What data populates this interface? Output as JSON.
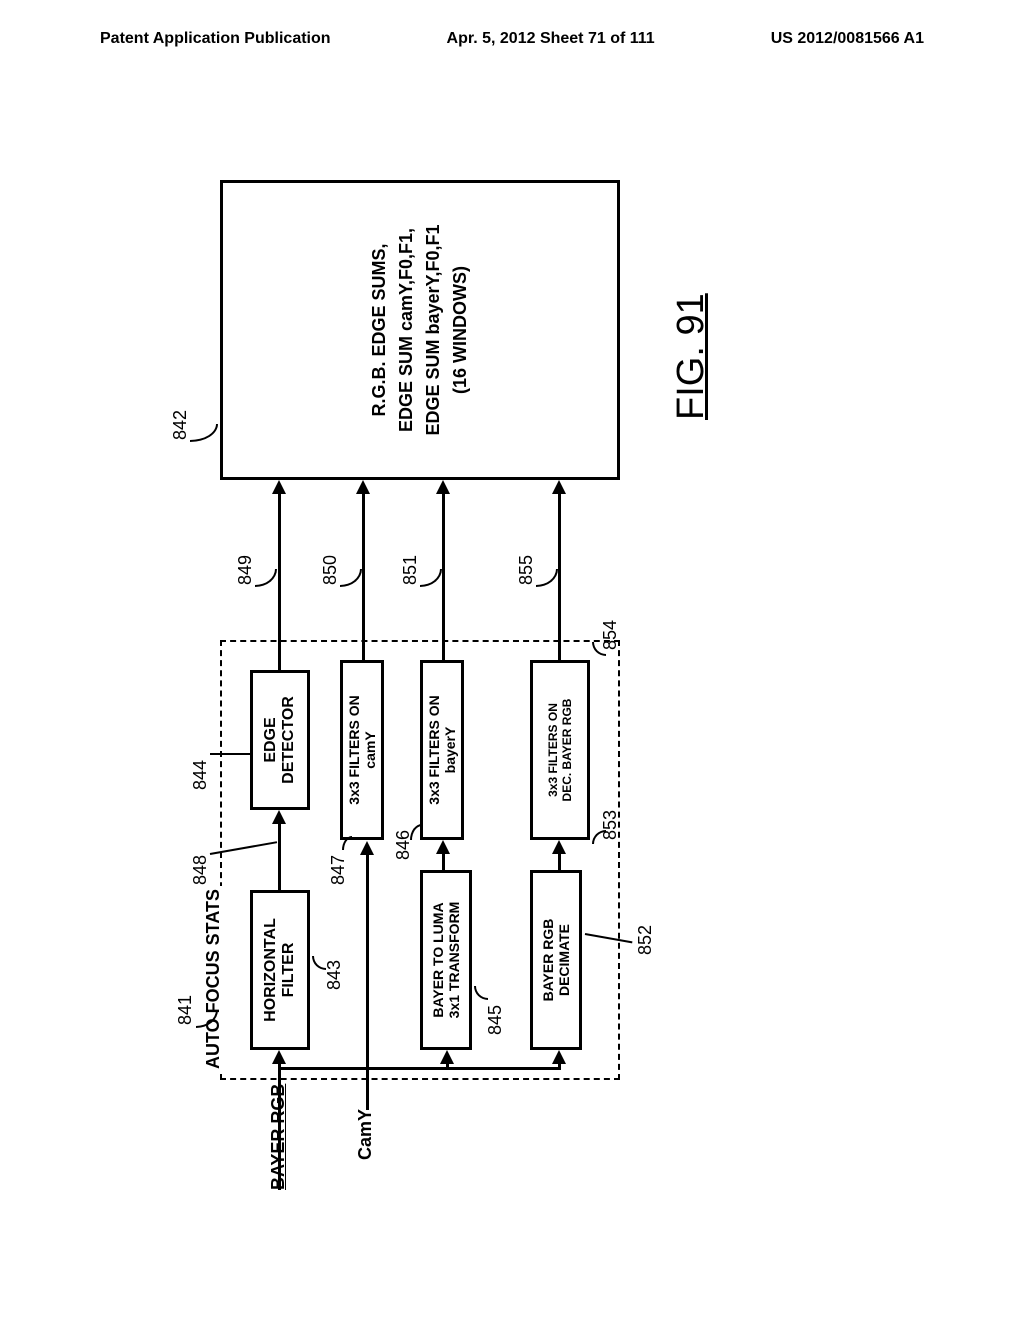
{
  "header": {
    "left": "Patent Application Publication",
    "center": "Apr. 5, 2012  Sheet 71 of 111",
    "right": "US 2012/0081566 A1"
  },
  "figure": {
    "title": "FIG. 91",
    "autofocus_title": "AUTO FOCUS STATS",
    "inputs": {
      "bayer_rgb": "BAYER RGB",
      "camy": "CamY"
    },
    "boxes": {
      "hfilter": "HORIZONTAL\nFILTER",
      "edge_detector": "EDGE\nDETECTOR",
      "filter_camy": "3x3 FILTERS ON\ncamY",
      "bayer_luma": "BAYER TO LUMA\n3x1 TRANSFORM",
      "filter_bayery": "3x3 FILTERS ON\nbayerY",
      "bayer_decimate": "BAYER RGB\nDECIMATE",
      "filter_decbayer": "3x3 FILTERS ON\nDEC. BAYER RGB"
    },
    "output": "R.G.B. EDGE SUMS,\nEDGE SUM camY,F0,F1,\nEDGE SUM bayerY,F0,F1\n(16 WINDOWS)",
    "refs": {
      "r841": "841",
      "r842": "842",
      "r843": "843",
      "r844": "844",
      "r845": "845",
      "r846": "846",
      "r847": "847",
      "r848": "848",
      "r849": "849",
      "r850": "850",
      "r851": "851",
      "r852": "852",
      "r853": "853",
      "r854": "854",
      "r855": "855"
    }
  }
}
